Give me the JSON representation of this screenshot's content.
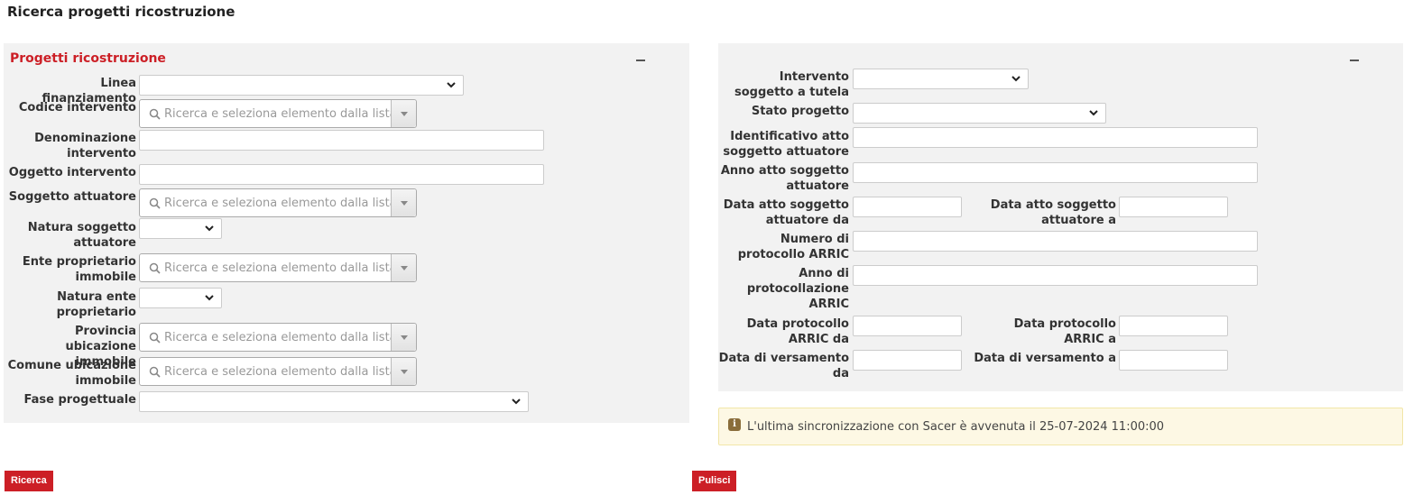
{
  "page": {
    "title": "Ricerca progetti ricostruzione"
  },
  "left_panel": {
    "title": "Progetti ricostruzione",
    "fields": {
      "linea_finanziamento": {
        "label": "Linea finanziamento",
        "value": ""
      },
      "codice_intervento": {
        "label": "Codice intervento",
        "placeholder": "Ricerca e seleziona elemento dalla lista..."
      },
      "denominazione_intervento": {
        "label": "Denominazione intervento",
        "value": ""
      },
      "oggetto_intervento": {
        "label": "Oggetto intervento",
        "value": ""
      },
      "soggetto_attuatore": {
        "label": "Soggetto attuatore",
        "placeholder": "Ricerca e seleziona elemento dalla lista..."
      },
      "natura_soggetto_attuatore": {
        "label": "Natura soggetto attuatore",
        "value": ""
      },
      "ente_proprietario_immobile": {
        "label": "Ente proprietario immobile",
        "placeholder": "Ricerca e seleziona elemento dalla lista..."
      },
      "natura_ente_proprietario": {
        "label": "Natura ente proprietario",
        "value": ""
      },
      "provincia_ubicazione_immobile": {
        "label": "Provincia ubicazione immobile",
        "placeholder": "Ricerca e seleziona elemento dalla lista..."
      },
      "comune_ubicazione_immobile": {
        "label": "Comune ubicazione immobile",
        "placeholder": "Ricerca e seleziona elemento dalla lista..."
      },
      "fase_progettuale": {
        "label": "Fase progettuale",
        "value": ""
      }
    }
  },
  "right_panel": {
    "fields": {
      "intervento_soggetto_tutela": {
        "label": "Intervento soggetto a tutela",
        "value": ""
      },
      "stato_progetto": {
        "label": "Stato progetto",
        "value": ""
      },
      "identificativo_atto": {
        "label": "Identificativo atto soggetto attuatore",
        "value": ""
      },
      "anno_atto": {
        "label": "Anno atto soggetto attuatore",
        "value": ""
      },
      "data_atto_da": {
        "label": "Data atto soggetto attuatore da",
        "value": ""
      },
      "data_atto_a": {
        "label": "Data atto soggetto attuatore a",
        "value": ""
      },
      "numero_protocollo": {
        "label": "Numero di protocollo ARRIC",
        "value": ""
      },
      "anno_protocollazione": {
        "label": "Anno di protocollazione ARRIC",
        "value": ""
      },
      "data_protocollo_da": {
        "label": "Data protocollo ARRIC da",
        "value": ""
      },
      "data_protocollo_a": {
        "label": "Data protocollo ARRIC a",
        "value": ""
      },
      "data_versamento_da": {
        "label": "Data di versamento da",
        "value": ""
      },
      "data_versamento_a": {
        "label": "Data di versamento a",
        "value": ""
      }
    }
  },
  "info": {
    "icon": "info-icon",
    "text": "L'ultima sincronizzazione con Sacer è avvenuta il 25-07-2024 11:00:00"
  },
  "buttons": {
    "search": "Ricerca",
    "clear": "Pulisci"
  },
  "colors": {
    "accent": "#cc1f26",
    "panel_bg": "#f2f2f2",
    "info_bg": "#fdf8e4"
  }
}
